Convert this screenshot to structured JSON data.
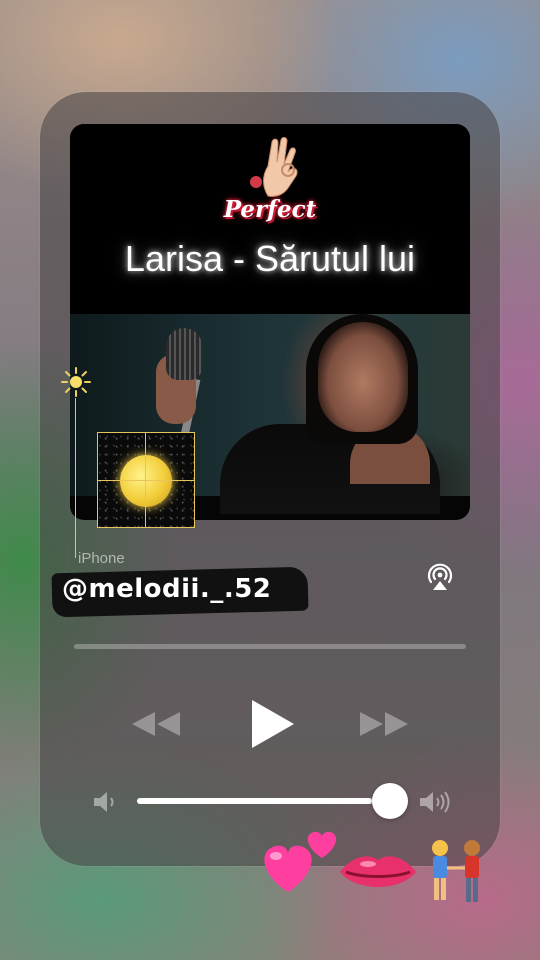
{
  "artwork": {
    "brand_text": "Perfect",
    "title": "Larisa - Sărutul lui"
  },
  "output_device": "iPhone",
  "overlay": {
    "handle": "@melodii._.52",
    "sticker_icons": [
      "sun-icon",
      "moon-icon",
      "heart-icon",
      "small-heart-icon",
      "lips-icon",
      "couple-icon"
    ]
  },
  "playback": {
    "progress_fraction": 0.0,
    "state": "paused",
    "volume_fraction": 0.87
  },
  "colors": {
    "guide_gold": "#e8c55a",
    "brand_red": "#e0223c",
    "heart_pink": "#ff3fa0"
  }
}
